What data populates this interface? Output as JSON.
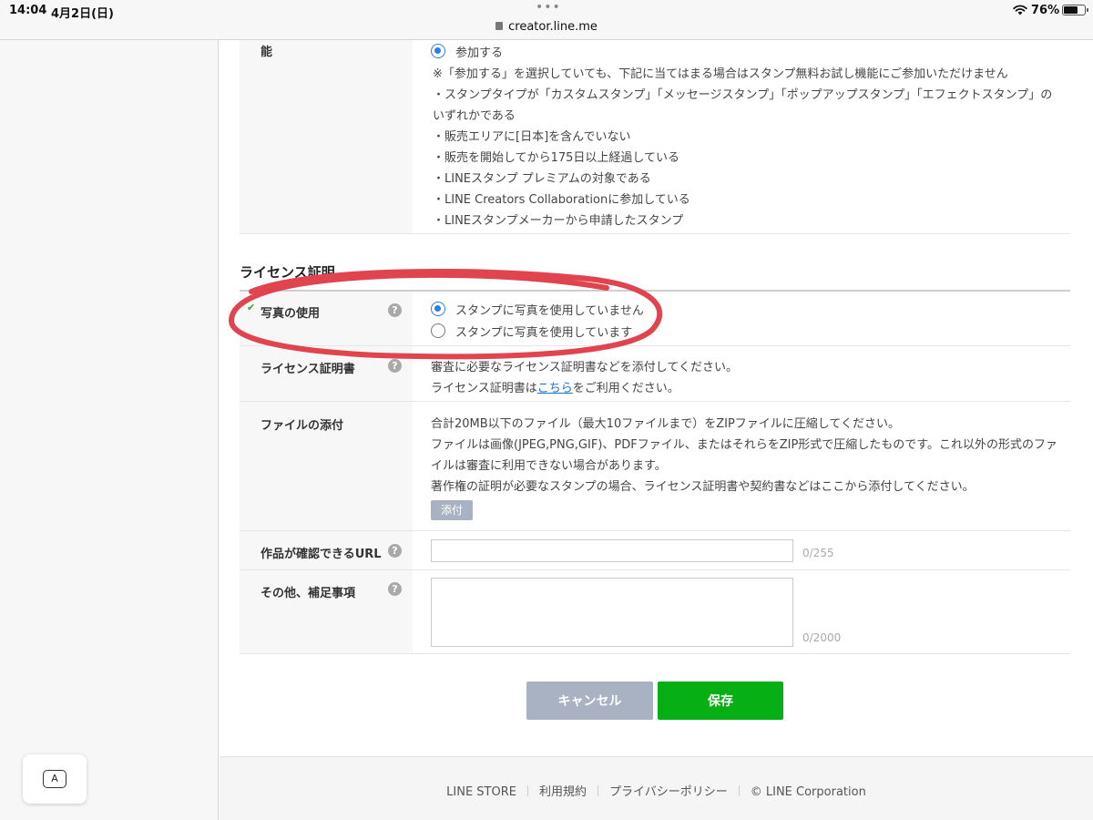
{
  "statusbar": {
    "time": "14:04",
    "date": "4月2日(日)",
    "dots": "•••",
    "url": "creator.line.me",
    "battery": "76%",
    "battery_level": 0.76
  },
  "keyboard_key": "A",
  "top_section": {
    "label_tail": "能",
    "option": "参加する",
    "lines": [
      "※「参加する」を選択していても、下記に当てはまる場合はスタンプ無料お試し機能にご参加いただけません",
      "・スタンプタイプが「カスタムスタンプ」「メッセージスタンプ」「ポップアップスタンプ」「エフェクトスタンプ」の",
      "いずれかである",
      "・販売エリアに[日本]を含んでいない",
      "・販売を開始してから175日以上経過している",
      "・LINEスタンプ プレミアムの対象である",
      "・LINE Creators Collaborationに参加している",
      "・LINEスタンプメーカーから申請したスタンプ"
    ]
  },
  "license": {
    "title": "ライセンス証明",
    "photo": {
      "label": "写真の使用",
      "check": "✔",
      "options": [
        "スタンプに写真を使用していません",
        "スタンプに写真を使用しています"
      ]
    },
    "certificate": {
      "label": "ライセンス証明書",
      "line1": "審査に必要なライセンス証明書などを添付してください。",
      "line2_pre": "ライセンス証明書は",
      "line2_link": "こちら",
      "line2_post": "をご利用ください。"
    },
    "attachment": {
      "label": "ファイルの添付",
      "lines": [
        "合計20MB以下のファイル（最大10ファイルまで）をZIPファイルに圧縮してください。",
        "ファイルは画像(JPEG,PNG,GIF)、PDFファイル、またはそれらをZIP形式で圧縮したものです。これ以外の形式のファ",
        "イルは審査に利用できない場合があります。",
        "著作権の証明が必要なスタンプの場合、ライセンス証明書や契約書などはここから添付してください。"
      ],
      "button": "添付"
    },
    "url": {
      "label": "作品が確認できるURL",
      "counter": "0/255"
    },
    "notes": {
      "label": "その他、補足事項",
      "counter": "0/2000"
    }
  },
  "buttons": {
    "cancel": "キャンセル",
    "save": "保存"
  },
  "footer": {
    "links": [
      "LINE STORE",
      "利用規約",
      "プライバシーポリシー",
      "© LINE Corporation"
    ]
  },
  "colors": {
    "accent": "#06b014",
    "radio": "#2a7ee8",
    "annotation": "#e0454f"
  }
}
